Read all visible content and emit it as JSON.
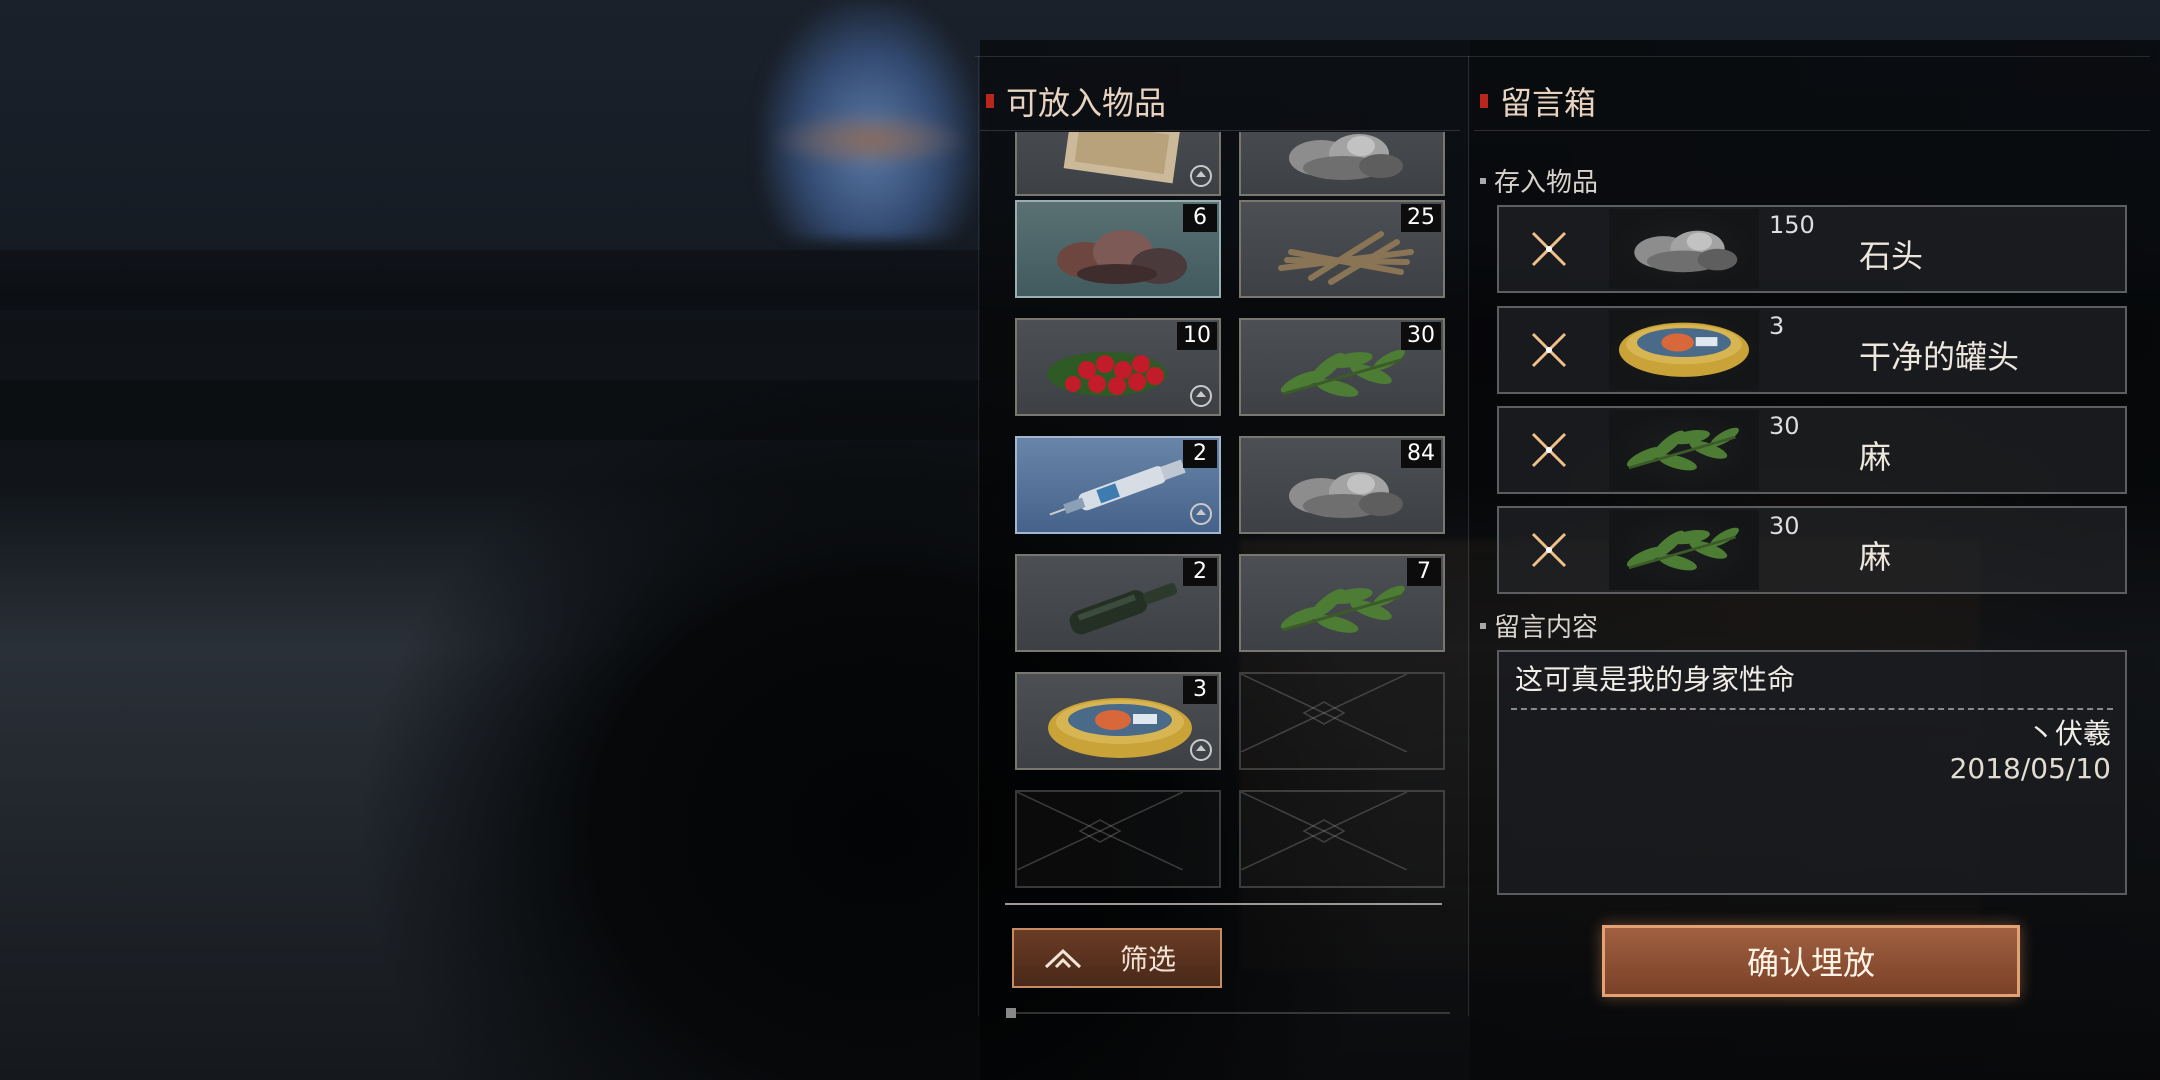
{
  "left_panel": {
    "title": "可放入物品",
    "filter_label": "筛选",
    "slots": [
      {
        "item": "map",
        "count": "",
        "bound": true
      },
      {
        "item": "stone",
        "count": "",
        "bound": false
      },
      {
        "item": "ore",
        "count": "6",
        "bound": false,
        "highlight": "green"
      },
      {
        "item": "wood",
        "count": "25",
        "bound": false
      },
      {
        "item": "berries",
        "count": "10",
        "bound": true
      },
      {
        "item": "hemp",
        "count": "30",
        "bound": false
      },
      {
        "item": "syringe",
        "count": "2",
        "bound": true,
        "highlight": "blue"
      },
      {
        "item": "stone",
        "count": "84",
        "bound": false
      },
      {
        "item": "bottle",
        "count": "2",
        "bound": false
      },
      {
        "item": "hemp",
        "count": "7",
        "bound": false
      },
      {
        "item": "tin-can",
        "count": "3",
        "bound": true
      },
      {
        "item": "empty",
        "count": ""
      },
      {
        "item": "empty",
        "count": ""
      },
      {
        "item": "empty",
        "count": ""
      }
    ]
  },
  "right_panel": {
    "title": "留言箱",
    "stored_title": "存入物品",
    "stored_items": [
      {
        "name": "石头",
        "qty": "150",
        "item": "stone"
      },
      {
        "name": "干净的罐头",
        "qty": "3",
        "item": "tin-can"
      },
      {
        "name": "麻",
        "qty": "30",
        "item": "hemp"
      },
      {
        "name": "麻",
        "qty": "30",
        "item": "hemp"
      }
    ],
    "message_title": "留言内容",
    "message": {
      "text": "这可真是我的身家性命",
      "signature": "丶伏羲",
      "date": "2018/05/10"
    },
    "confirm_label": "确认埋放"
  },
  "colors": {
    "accent_red": "#b8261c",
    "button_brown": "#7a4128",
    "button_border": "#e2a273",
    "remove_x": "#f0c08a"
  }
}
